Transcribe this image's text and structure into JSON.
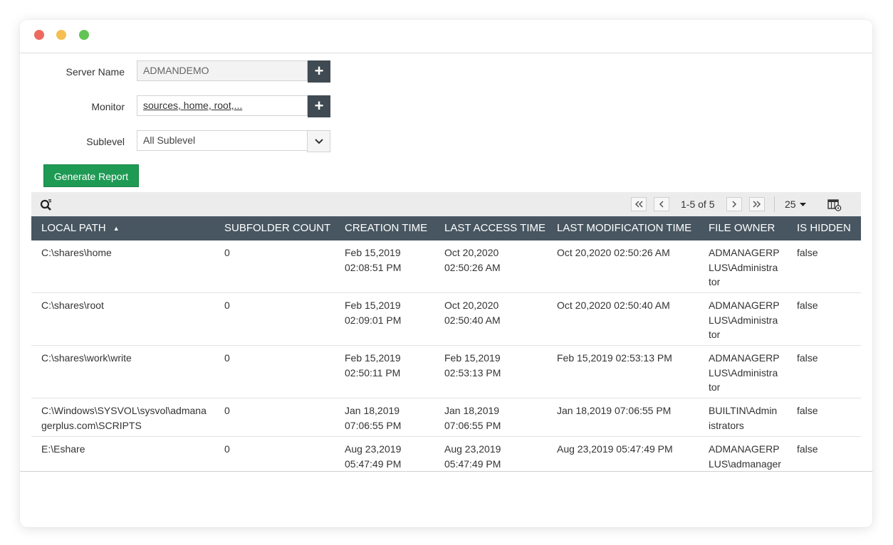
{
  "window": {
    "controls": [
      "close",
      "minimize",
      "maximize"
    ]
  },
  "form": {
    "server_name": {
      "label": "Server Name",
      "value": "ADMANDEMO"
    },
    "monitor": {
      "label": "Monitor",
      "value": "sources, home, root,..."
    },
    "sublevel": {
      "label": "Sublevel",
      "value": "All Sublevel"
    },
    "generate_label": "Generate Report"
  },
  "toolbar": {
    "page_info": "1-5 of 5",
    "per_page": "25"
  },
  "table": {
    "columns": [
      "LOCAL PATH",
      "SUBFOLDER COUNT",
      "CREATION TIME",
      "LAST ACCESS TIME",
      "LAST MODIFICATION TIME",
      "FILE OWNER",
      "IS HIDDEN"
    ],
    "sort_indicator": "▲",
    "rows": [
      {
        "local_path": "C:\\shares\\home",
        "subfolder_count": "0",
        "creation_time": "Feb 15,2019\n02:08:51 PM",
        "last_access_time": "Oct 20,2020\n02:50:26 AM",
        "last_modification_time": "Oct 20,2020 02:50:26 AM",
        "file_owner": "ADMANAGERP\nLUS\\Administra\ntor",
        "is_hidden": "false"
      },
      {
        "local_path": "C:\\shares\\root",
        "subfolder_count": "0",
        "creation_time": "Feb 15,2019\n02:09:01 PM",
        "last_access_time": "Oct 20,2020\n02:50:40 AM",
        "last_modification_time": "Oct 20,2020 02:50:40 AM",
        "file_owner": "ADMANAGERP\nLUS\\Administra\ntor",
        "is_hidden": "false"
      },
      {
        "local_path": "C:\\shares\\work\\write",
        "subfolder_count": "0",
        "creation_time": "Feb 15,2019\n02:50:11 PM",
        "last_access_time": "Feb 15,2019\n02:53:13 PM",
        "last_modification_time": "Feb 15,2019 02:53:13 PM",
        "file_owner": "ADMANAGERP\nLUS\\Administra\ntor",
        "is_hidden": "false"
      },
      {
        "local_path": "C:\\Windows\\SYSVOL\\sysvol\\admana\ngerplus.com\\SCRIPTS",
        "subfolder_count": "0",
        "creation_time": "Jan 18,2019\n07:06:55 PM",
        "last_access_time": "Jan 18,2019\n07:06:55 PM",
        "last_modification_time": "Jan 18,2019 07:06:55 PM",
        "file_owner": "BUILTIN\\Admin\nistrators",
        "is_hidden": "false"
      },
      {
        "local_path": "E:\\Eshare",
        "subfolder_count": "0",
        "creation_time": "Aug 23,2019\n05:47:49 PM",
        "last_access_time": "Aug 23,2019\n05:47:49 PM",
        "last_modification_time": "Aug 23,2019 05:47:49 PM",
        "file_owner": "ADMANAGERP\nLUS\\admanager",
        "is_hidden": "false"
      }
    ]
  },
  "colors": {
    "header_bg": "#475661",
    "generate_button": "#1f9a54",
    "plus_button": "#3f4a52",
    "toolbar_bg": "#ececec"
  },
  "icons": [
    "plus-icon",
    "chevron-down-icon",
    "search-filter-icon",
    "first-page-icon",
    "prev-page-icon",
    "next-page-icon",
    "last-page-icon",
    "caret-down-icon",
    "column-settings-icon",
    "sort-asc-icon"
  ]
}
